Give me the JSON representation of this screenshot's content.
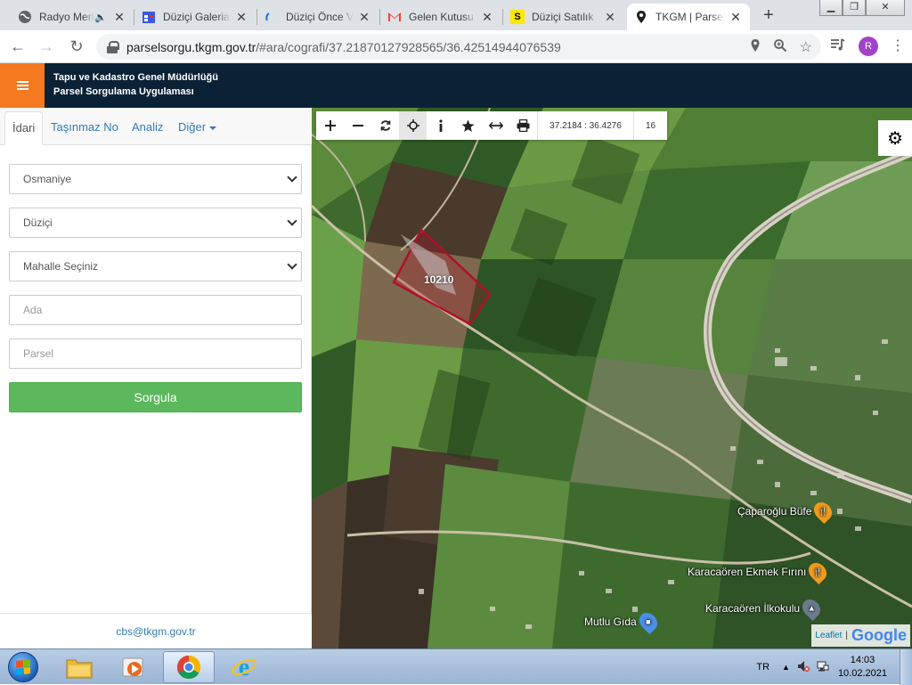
{
  "browser": {
    "tabs": [
      {
        "title": "Radyo Merkez",
        "icon": "globe-icon"
      },
      {
        "title": "Düziçi Galeria",
        "icon": "calendar-icon"
      },
      {
        "title": "Düziçi Önce Vatan",
        "icon": "loading-spinner-icon"
      },
      {
        "title": "Gelen Kutusu",
        "icon": "gmail-icon"
      },
      {
        "title": "Düziçi Satılık",
        "icon": "sahibinden-icon"
      },
      {
        "title": "TKGM | Parsel",
        "icon": "map-pin-icon"
      }
    ],
    "new_tab": "+",
    "url_host": "parselsorgu.tkgm.gov.tr",
    "url_path": "/#ara/cografi/37.21870127928565/36.42514944076539",
    "profile_initial": "R"
  },
  "app": {
    "title_line1": "Tapu ve Kadastro Genel Müdürlüğü",
    "title_line2": "Parsel Sorgulama Uygulaması"
  },
  "panel": {
    "tabs": [
      "İdari",
      "Taşınmaz No",
      "Analiz",
      "Diğer"
    ],
    "active_tab": "İdari",
    "province": "Osmaniye",
    "district": "Düziçi",
    "neighborhood": "Mahalle Seçiniz",
    "block_placeholder": "Ada",
    "parcel_placeholder": "Parsel",
    "query_button": "Sorgula",
    "footer_email": "cbs@tkgm.gov.tr"
  },
  "map": {
    "coordinates": "37.2184 : 36.4276",
    "zoom": "16",
    "parcel_label": "10210",
    "pois": [
      {
        "name": "Çaparoğlu Büfe",
        "icon": "restaurant-pin-icon",
        "color": "#f09a1e"
      },
      {
        "name": "Karacaören Ekmek Fırını",
        "icon": "restaurant-pin-icon",
        "color": "#f09a1e"
      },
      {
        "name": "Karacaören İlkokulu",
        "icon": "school-pin-icon",
        "color": "#6b7a8c"
      },
      {
        "name": "Mutlu Gıda",
        "icon": "shopping-pin-icon",
        "color": "#4b8ee6"
      }
    ],
    "attribution_leaflet": "Leaflet",
    "attribution_google": "Google",
    "parcel_outline_color": "#b0102a"
  },
  "taskbar": {
    "language": "TR",
    "time": "14:03",
    "date": "10.02.2021"
  }
}
